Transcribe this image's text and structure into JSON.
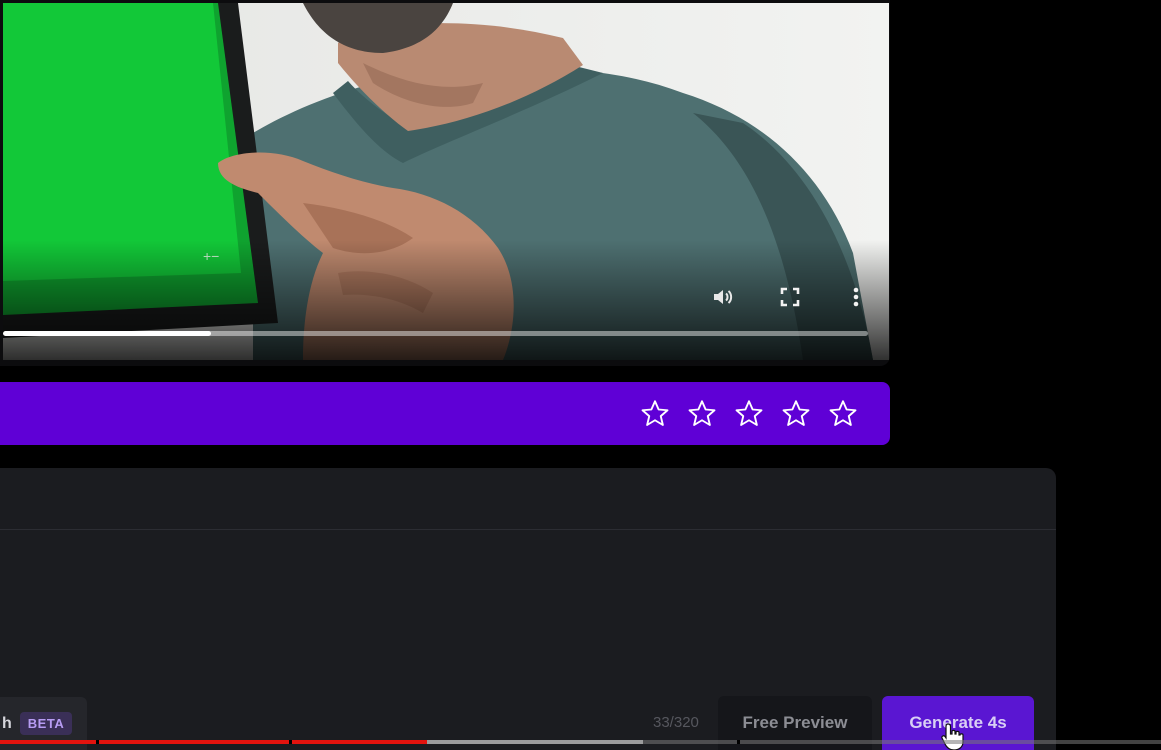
{
  "video": {
    "progress_fraction": 0.24,
    "controls": {
      "volume_icon": "volume-icon",
      "fullscreen_icon": "fullscreen-icon",
      "more_icon": "more-vertical-icon"
    }
  },
  "rating": {
    "star_count": 5,
    "filled": 0,
    "bar_color": "#5f00d6",
    "star_icon": "star-outline-icon"
  },
  "prompt": {
    "value": "",
    "char_count": "33/320"
  },
  "mode_chip": {
    "label": "h",
    "badge": "BETA"
  },
  "actions": {
    "preview_label": "Free Preview",
    "generate_label": "Generate 4s",
    "generate_color": "#5a16d2"
  },
  "outer_player": {
    "played_fraction": 0.368,
    "buffered_fraction": 0.554,
    "played_color": "#e3130e"
  }
}
